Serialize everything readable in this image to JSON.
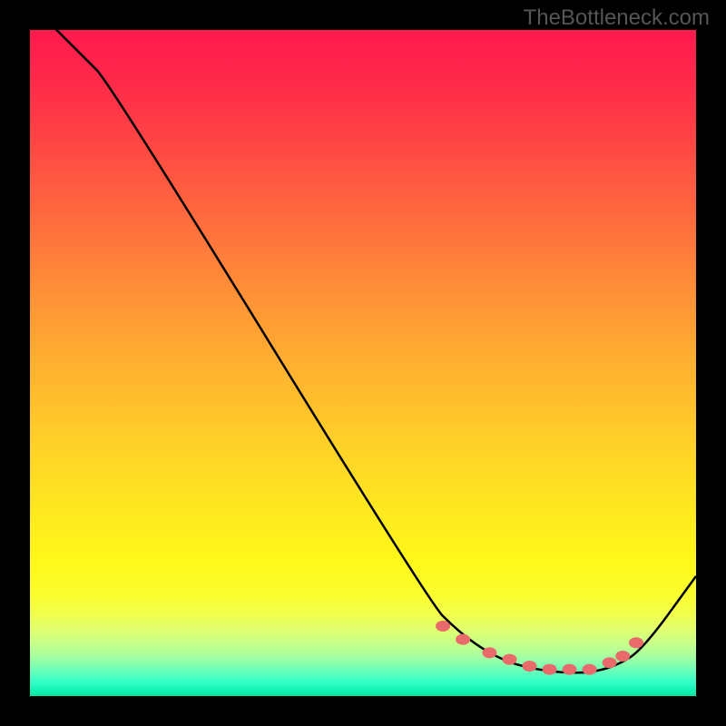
{
  "watermark": "TheBottleneck.com",
  "chart_data": {
    "type": "line",
    "title": "",
    "xlabel": "",
    "ylabel": "",
    "xlim": [
      0,
      100
    ],
    "ylim": [
      0,
      100
    ],
    "series": [
      {
        "name": "curve",
        "x": [
          0,
          4,
          8,
          12,
          60,
          64,
          68,
          72,
          76,
          80,
          84,
          88,
          92,
          100
        ],
        "y": [
          104,
          100,
          96,
          92,
          14,
          10,
          7,
          5,
          4,
          3.5,
          3.5,
          4.5,
          7,
          18
        ]
      }
    ],
    "markers": {
      "name": "highlight-dots",
      "x": [
        62,
        65,
        69,
        72,
        75,
        78,
        81,
        84,
        87,
        89,
        91
      ],
      "y": [
        10.5,
        8.5,
        6.5,
        5.5,
        4.5,
        4.0,
        4.0,
        4.0,
        5.0,
        6.0,
        8.0
      ]
    },
    "background_gradient": {
      "top_color": "#ff1a4d",
      "mid_color": "#ffe820",
      "bottom_color": "#00e8a0"
    }
  }
}
